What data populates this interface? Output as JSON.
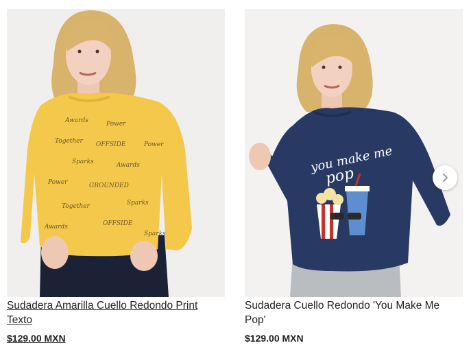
{
  "products": [
    {
      "title": "Sudadera Amarilla Cuello Redondo Print Texto",
      "price": "$129.00 MXN",
      "image_alt": "Mujer con sudadera amarilla estampada",
      "sweater_color": "#f4c84a",
      "pants_color": "#1c2236"
    },
    {
      "title": "Sudadera Cuello Redondo 'You Make Me Pop'",
      "price": "$129.00 MXN",
      "image_alt": "Mujer con sudadera azul marino con estampado de palomitas",
      "sweater_color": "#283a63",
      "pants_color": "#b9bcc1",
      "print_text": "you make me pop"
    }
  ],
  "navigation": {
    "next_icon": "chevron-right-icon"
  }
}
